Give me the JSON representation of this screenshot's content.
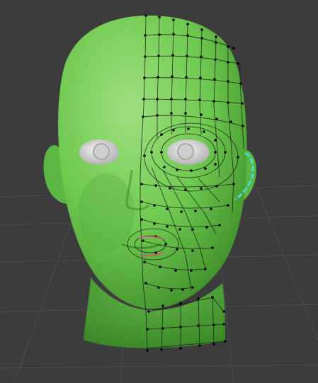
{
  "viewport": {
    "background": "#3c3c3c",
    "grid_color": "#4a4a4a",
    "mode": "edit-mode",
    "object": "head-mesh"
  },
  "model": {
    "skin_color": "#6ec94f",
    "skin_highlight": "#9be27a",
    "skin_shadow": "#3f8f2a",
    "eye_color": "#e6e6e6",
    "wire_color": "#111111",
    "vertex_color": "#000000"
  },
  "selection": {
    "selected_edge_color": "#3fe0d0",
    "highlight_edge_color": "#e04a7a"
  }
}
